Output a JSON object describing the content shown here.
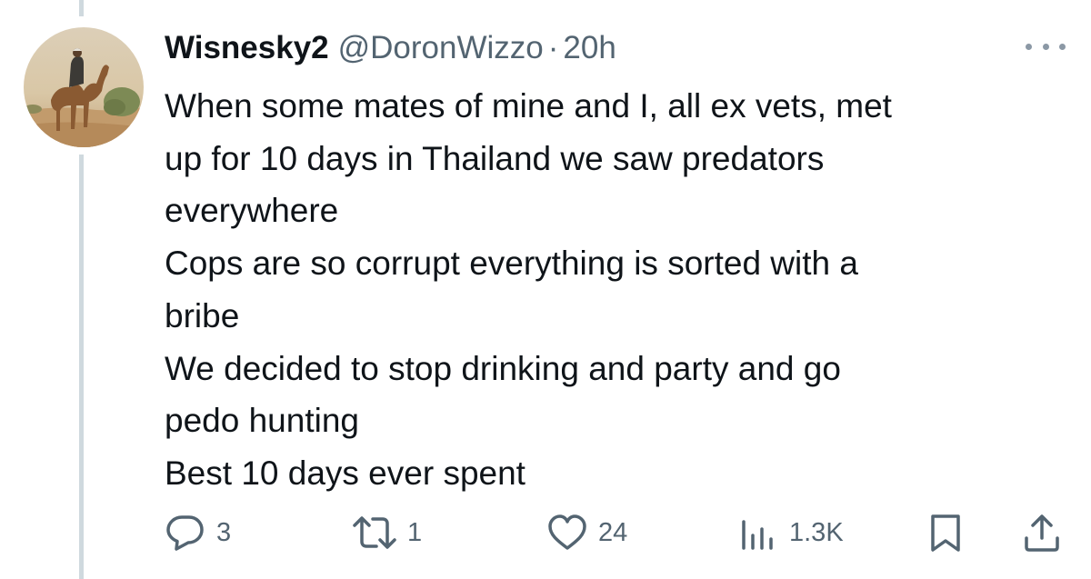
{
  "tweet": {
    "display_name": "Wisnesky2",
    "handle": "@DoronWizzo",
    "separator": "·",
    "time": "20h",
    "text_lines": [
      "When some mates of mine and I, all ex vets,  met",
      "up for 10 days in Thailand we saw predators",
      "everywhere",
      "Cops are so corrupt everything is sorted with a",
      "bribe",
      "We decided to stop drinking and party and go",
      "pedo hunting",
      "Best 10 days ever spent"
    ]
  },
  "actions": {
    "reply_count": "3",
    "retweet_count": "1",
    "like_count": "24",
    "views_count": "1.3K"
  },
  "icons": {
    "more": "more-dots-icon",
    "reply": "reply-bubble-icon",
    "retweet": "retweet-arrows-icon",
    "like": "heart-icon",
    "views": "views-bars-icon",
    "bookmark": "bookmark-icon",
    "share": "share-upload-icon"
  },
  "colors": {
    "text": "#0f1419",
    "secondary": "#536471",
    "thread_line": "#cfd9de"
  }
}
